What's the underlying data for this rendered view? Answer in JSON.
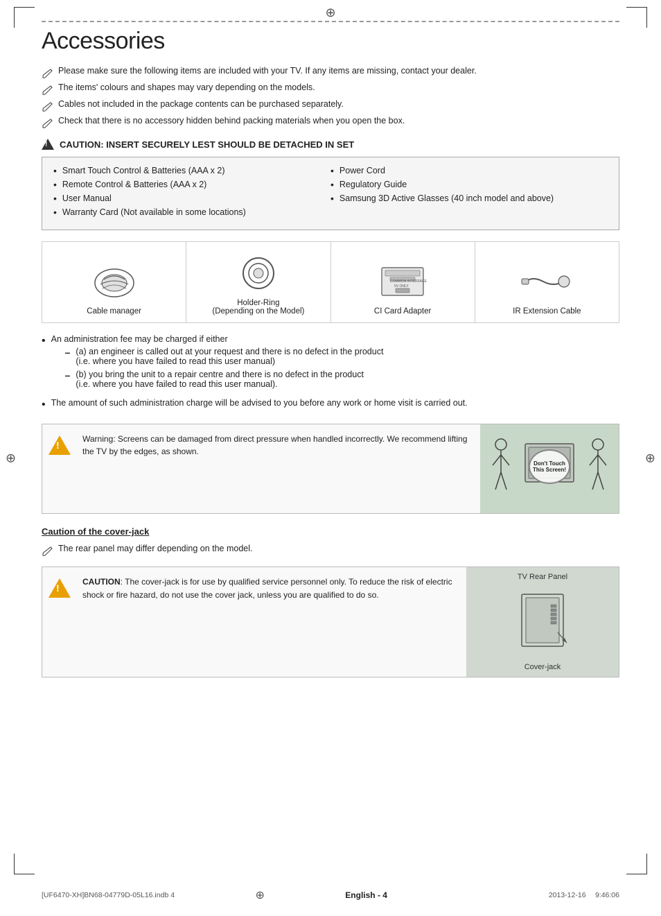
{
  "page": {
    "title": "Accessories",
    "dashed_line": true,
    "top_icon": "⊕",
    "side_icon_left": "⊕",
    "side_icon_right": "⊕"
  },
  "notes": [
    "Please make sure the following items are included with your TV. If any items are missing, contact your dealer.",
    "The items' colours and shapes may vary depending on the models.",
    "Cables not included in the package contents can be purchased separately.",
    "Check that there is no accessory hidden behind packing materials when you open the box."
  ],
  "caution_header": "CAUTION: INSERT SECURELY LEST SHOULD BE DETACHED IN SET",
  "accessories_left": [
    "Smart Touch Control & Batteries (AAA x 2)",
    "Remote Control & Batteries (AAA x 2)",
    "User Manual",
    "Warranty Card (Not available in some locations)"
  ],
  "accessories_right": [
    "Power Cord",
    "Regulatory Guide",
    "Samsung 3D Active Glasses (40 inch model and above)"
  ],
  "illustrations": [
    {
      "label": "Cable manager"
    },
    {
      "label": "Holder-Ring\n(Depending on the Model)"
    },
    {
      "label": "CI Card Adapter"
    },
    {
      "label": "IR Extension Cable"
    }
  ],
  "body_bullets": [
    "An administration fee may be charged if either"
  ],
  "sub_dashes": [
    {
      "text": "(a) an engineer is called out at your request and there is no defect in the product\n(i.e. where you have failed to read this user manual)"
    },
    {
      "text": "(b) you bring the unit to a repair centre and there is no defect in the product\n(i.e. where you have failed to read this user manual)."
    }
  ],
  "last_bullet": "The amount of such administration charge will be advised to you before any work or home visit is carried out.",
  "warning": {
    "text": "Warning: Screens can be damaged from direct pressure when handled incorrectly. We recommend lifting the TV by the edges, as shown.",
    "badge_line1": "Don't Touch",
    "badge_line2": "This Screen!"
  },
  "caution_section": {
    "title": "Caution of the cover-jack",
    "note": "The rear panel may differ depending on the model.",
    "caution_bold": "CAUTION",
    "caution_text": ": The cover-jack is for use by qualified service personnel only. To reduce the risk of electric shock or fire hazard, do not use the cover jack, unless you are qualified to do so.",
    "tv_rear_label": "TV Rear Panel",
    "cover_jack_label": "Cover-jack"
  },
  "footer": {
    "left": "[UF6470-XH]BN68-04779D-05L16.indb   4",
    "center": "English - 4",
    "right": "2013-12-16    9:46:06",
    "bottom_icon": "⊕"
  }
}
